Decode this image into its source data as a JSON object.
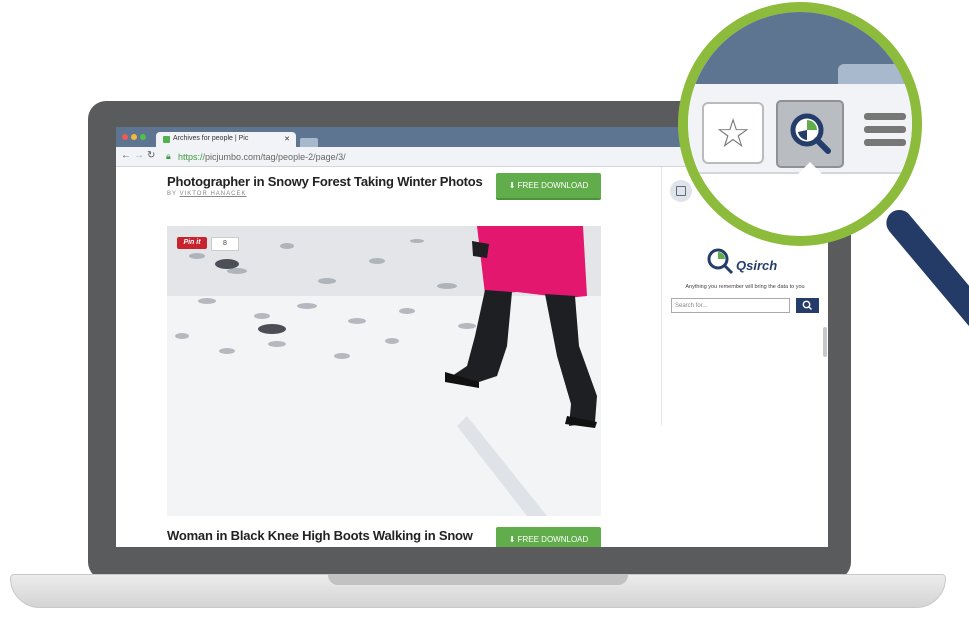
{
  "browser": {
    "tab_title": "Archives for people | Pic",
    "tab_close": "✕",
    "url_protocol": "https://",
    "url_rest": "picjumbo.com/tag/people-2/page/3/"
  },
  "posts": [
    {
      "title": "Photographer in Snowy Forest Taking Winter Photos",
      "by_label": "BY",
      "author": "VIKTOR HANACEK",
      "download_label": "FREE DOWNLOAD"
    },
    {
      "title": "Woman in Black Knee High Boots Walking in Snow",
      "download_label": "FREE DOWNLOAD"
    }
  ],
  "pin": {
    "label": "Pin it",
    "count": "8"
  },
  "extension": {
    "brand": "Qsirch",
    "tagline": "Anything you remember will bring the data to you",
    "search_placeholder": "Search for..."
  },
  "colors": {
    "accent_green": "#61ad4c",
    "brand_navy": "#243d6b",
    "lens_ring": "#8dbb3c",
    "tab_bar": "#5d7591"
  }
}
